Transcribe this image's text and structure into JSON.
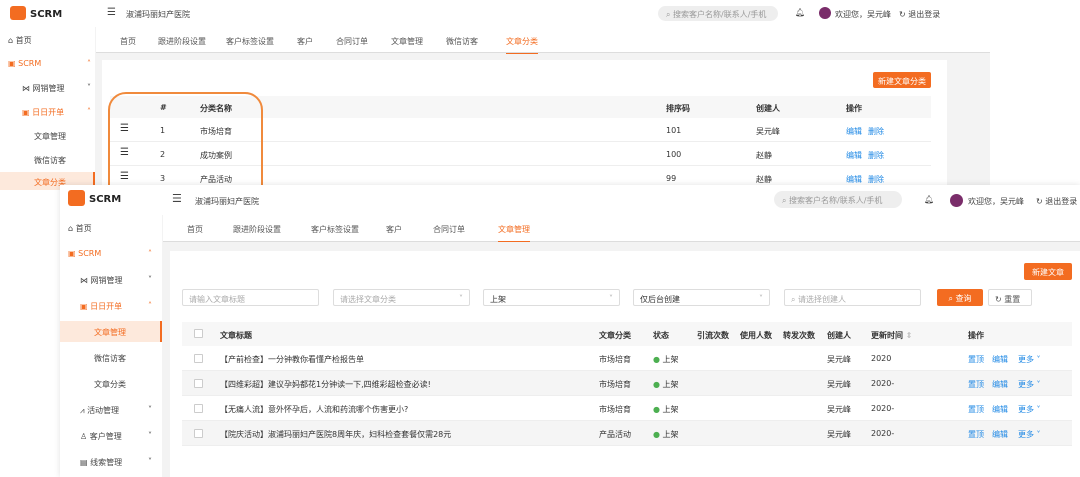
{
  "app": {
    "name": "SCRM",
    "org": "淑浦玛丽妇产医院",
    "search_placeholder": "搜索客户名称/联系人/手机",
    "welcome": "欢迎您，吴元峰",
    "logout": "退出登录"
  },
  "sidebar": {
    "home": "首页",
    "scrm": "SCRM",
    "wangxiao": "网销管理",
    "riri": "日日开单",
    "wenzhang": "文章管理",
    "weixin": "微信访客",
    "fenlei": "文章分类",
    "huodong": "活动管理",
    "kehu": "客户管理",
    "xiansuo": "线索管理"
  },
  "back": {
    "tabs": [
      "首页",
      "跟进阶段设置",
      "客户标签设置",
      "客户",
      "合同订单",
      "文章管理",
      "微信访客",
      "文章分类"
    ],
    "new_button": "新建文章分类",
    "columns": [
      "#",
      "分类名称",
      "排序码",
      "创建人",
      "操作"
    ],
    "rows": [
      {
        "n": "1",
        "name": "市场培育",
        "sort": "101",
        "creator": "吴元峰",
        "edit": "编辑",
        "del": "删除"
      },
      {
        "n": "2",
        "name": "成功案例",
        "sort": "100",
        "creator": "赵静",
        "edit": "编辑",
        "del": "删除"
      },
      {
        "n": "3",
        "name": "产品活动",
        "sort": "99",
        "creator": "赵静",
        "edit": "编辑",
        "del": "删除"
      }
    ]
  },
  "front": {
    "tabs": [
      "首页",
      "跟进阶段设置",
      "客户标签设置",
      "客户",
      "合同订单",
      "文章管理"
    ],
    "new_button": "新建文章",
    "filters": {
      "title_placeholder": "请输入文章标题",
      "category_placeholder": "请选择文章分类",
      "status": "上架",
      "source": "仅后台创建",
      "creator_placeholder": "请选择创建人",
      "query": "查询",
      "reset": "重置"
    },
    "columns": [
      "文章标题",
      "文章分类",
      "状态",
      "引流次数",
      "使用人数",
      "转发次数",
      "创建人",
      "更新时间",
      "操作"
    ],
    "rows": [
      {
        "title": "【产前检查】一分钟教你看懂产检报告单",
        "category": "市场培育",
        "status": "上架",
        "creator": "吴元峰",
        "time": "2020"
      },
      {
        "title": "【四维彩超】建议孕妈都花1分钟读一下,四维彩超检查必读!",
        "category": "市场培育",
        "status": "上架",
        "creator": "吴元峰",
        "time": "2020-"
      },
      {
        "title": "【无痛人流】意外怀孕后，人流和药流哪个伤害更小?",
        "category": "市场培育",
        "status": "上架",
        "creator": "吴元峰",
        "time": "2020-"
      },
      {
        "title": "【院庆活动】淑浦玛丽妇产医院8周年庆，妇科检查套餐仅需28元",
        "category": "产品活动",
        "status": "上架",
        "creator": "吴元峰",
        "time": "2020-"
      }
    ],
    "ops": {
      "top": "置顶",
      "edit": "编辑",
      "more": "更多"
    }
  },
  "colors": {
    "accent": "#f36c21",
    "link": "#1e88e5",
    "online": "#4caf50"
  }
}
